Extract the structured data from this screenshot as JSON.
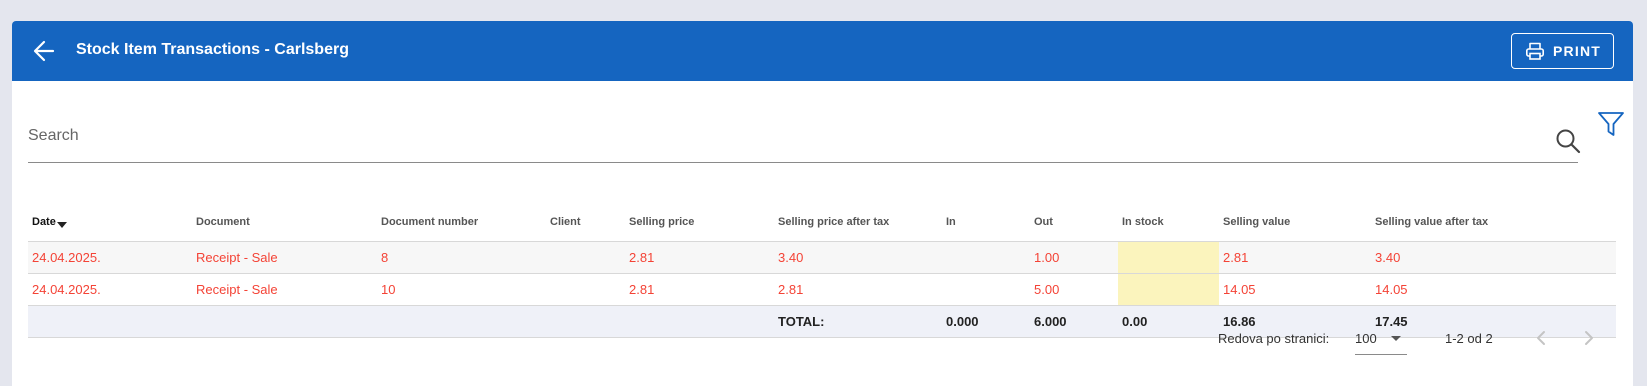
{
  "header": {
    "title": "Stock Item Transactions - Carlsberg",
    "print_label": "PRINT",
    "color": "#1565c0"
  },
  "search": {
    "placeholder": "Search"
  },
  "table": {
    "columns": [
      "Date",
      "Document",
      "Document number",
      "Client",
      "Selling price",
      "Selling price after tax",
      "In",
      "Out",
      "In stock",
      "Selling value",
      "Selling value after tax"
    ],
    "sorted_column": "Date",
    "sort_direction": "descending",
    "rows": [
      [
        "24.04.2025.",
        "Receipt - Sale",
        "8",
        "",
        "2.81",
        "3.40",
        "",
        "1.00",
        "",
        "2.81",
        "3.40"
      ],
      [
        "24.04.2025.",
        "Receipt - Sale",
        "10",
        "",
        "2.81",
        "2.81",
        "",
        "5.00",
        "",
        "14.05",
        "14.05"
      ]
    ],
    "total": {
      "label": "TOTAL:",
      "in": "0.000",
      "out": "6.000",
      "in_stock": "0.00",
      "selling_value": "16.86",
      "selling_value_after_tax": "17.45"
    },
    "row_text_color": "#f44336",
    "stock_highlight_color": "#fbf4bd"
  },
  "pagination": {
    "rows_per_page_label": "Redova po stranici:",
    "rows_per_page": "100",
    "range": "1-2 od 2"
  },
  "icons": [
    "arrow-left-icon",
    "printer-icon",
    "search-icon",
    "filter-icon",
    "chevron-down-icon",
    "chevron-left-icon",
    "chevron-right-icon"
  ]
}
